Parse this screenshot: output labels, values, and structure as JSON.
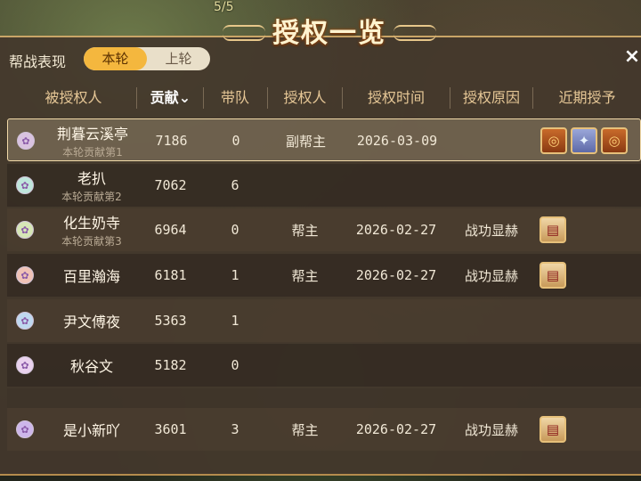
{
  "window": {
    "title": "授权一览",
    "top_counter": "5/5",
    "close_label": "×"
  },
  "filter": {
    "label": "帮战表现",
    "options": [
      "本轮",
      "上轮"
    ],
    "selected": "本轮"
  },
  "columns": [
    {
      "key": "name",
      "label": "被授权人"
    },
    {
      "key": "contribution",
      "label": "贡献",
      "sorted": "desc"
    },
    {
      "key": "team",
      "label": "带队"
    },
    {
      "key": "grantor",
      "label": "授权人"
    },
    {
      "key": "time",
      "label": "授权时间"
    },
    {
      "key": "reason",
      "label": "授权原因"
    },
    {
      "key": "recent",
      "label": "近期授予"
    }
  ],
  "sort_icon": "chevron-down-icon",
  "rows": [
    {
      "name": "荆暮云溪亭",
      "rank_text": "本轮贡献第1",
      "contribution": "7186",
      "team": "0",
      "grantor": "副帮主",
      "time": "2026-03-09",
      "reason": "",
      "recent": [
        "pouch-icon",
        "orb-icon",
        "pouch-icon"
      ],
      "avatar_color": "#d9c2e0"
    },
    {
      "name": "老扒",
      "rank_text": "本轮贡献第2",
      "contribution": "7062",
      "team": "6",
      "grantor": "",
      "time": "",
      "reason": "",
      "recent": [],
      "avatar_color": "#bfe6dc"
    },
    {
      "name": "化生奶寺",
      "rank_text": "本轮贡献第3",
      "contribution": "6964",
      "team": "0",
      "grantor": "帮主",
      "time": "2026-02-27",
      "reason": "战功显赫",
      "recent": [
        "scroll-icon"
      ],
      "avatar_color": "#d6e6b6"
    },
    {
      "name": "百里瀚海",
      "rank_text": "",
      "contribution": "6181",
      "team": "1",
      "grantor": "帮主",
      "time": "2026-02-27",
      "reason": "战功显赫",
      "recent": [
        "scroll-icon"
      ],
      "avatar_color": "#f0c2b6"
    },
    {
      "name": "尹文傅夜",
      "rank_text": "",
      "contribution": "5363",
      "team": "1",
      "grantor": "",
      "time": "",
      "reason": "",
      "recent": [],
      "avatar_color": "#bfd8f0"
    },
    {
      "name": "秋谷文",
      "rank_text": "",
      "contribution": "5182",
      "team": "0",
      "grantor": "",
      "time": "",
      "reason": "",
      "recent": [],
      "avatar_color": "#ead2ee"
    },
    {
      "name": "是小新吖",
      "rank_text": "",
      "contribution": "3601",
      "team": "3",
      "grantor": "帮主",
      "time": "2026-02-27",
      "reason": "战功显赫",
      "recent": [
        "scroll-icon"
      ],
      "avatar_color": "#cdb6ea"
    }
  ]
}
